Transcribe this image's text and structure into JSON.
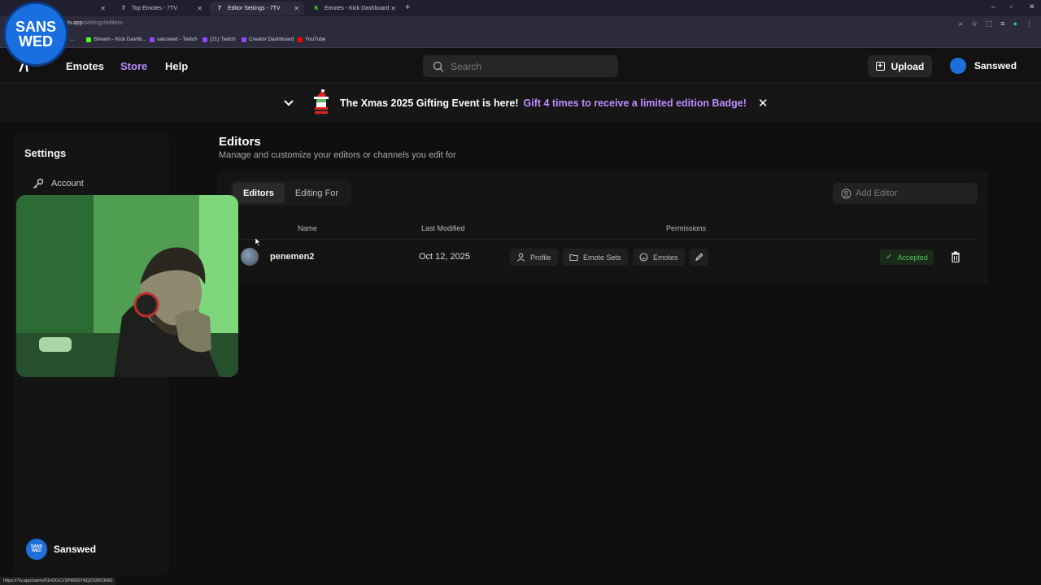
{
  "browser": {
    "tabs": [
      {
        "title": "",
        "active": false
      },
      {
        "title": "Top Emotes - 7TV",
        "active": false
      },
      {
        "title": "Editor Settings - 7TV",
        "active": true
      },
      {
        "title": "Emotes - Kick Dashboard",
        "active": false
      }
    ],
    "url_host": "tv.app",
    "url_path": "/settings/editors",
    "bookmarks": [
      "...",
      "Stream - Kick Dashb...",
      "sanswed - Twitch",
      "(21) Twitch",
      "Creator Dashboard",
      "YouTube"
    ],
    "status_url": "https://7tv.app/users/01H2GCV2P80007NQZ108V3060"
  },
  "overlay": {
    "logo_line1": "SANS",
    "logo_line2": "WED"
  },
  "nav": {
    "emotes": "Emotes",
    "store": "Store",
    "help": "Help",
    "search_placeholder": "Search",
    "upload": "Upload",
    "username": "Sanswed"
  },
  "banner": {
    "text": "The Xmas 2025 Gifting Event is here!",
    "link": "Gift 4 times to receive a limited edition Badge!"
  },
  "sidebar": {
    "title": "Settings",
    "items": [
      {
        "label": "Account",
        "icon": "key-icon"
      }
    ],
    "user": "Sanswed"
  },
  "main": {
    "title": "Editors",
    "subtitle": "Manage and customize your editors or channels you edit for",
    "tabs": [
      "Editors",
      "Editing For"
    ],
    "add_editor_placeholder": "Add Editor",
    "columns": [
      "Name",
      "Last Modified",
      "Permissions"
    ],
    "rows": [
      {
        "name": "penemen2",
        "last_modified": "Oct 12, 2025",
        "permissions": [
          "Profile",
          "Emote Sets",
          "Emotes"
        ],
        "status": "Accepted"
      }
    ]
  },
  "colors": {
    "accent": "#b98cff",
    "status_ok": "#4cc25a",
    "background": "#0f0f0f"
  }
}
